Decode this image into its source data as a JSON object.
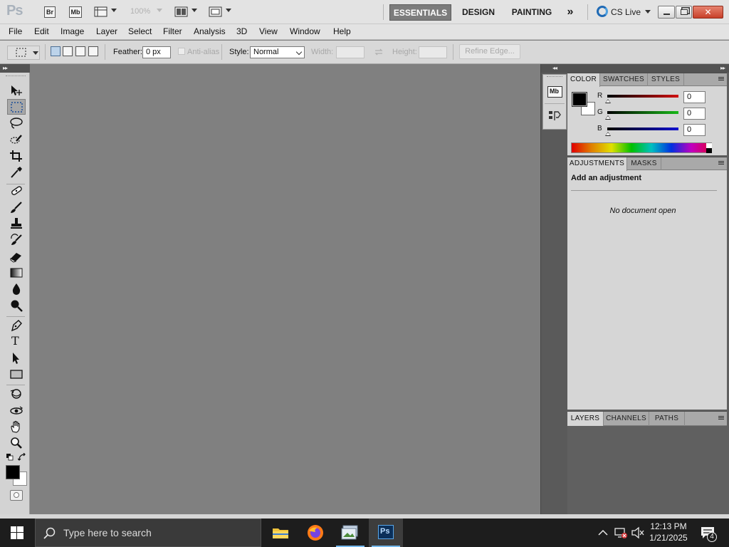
{
  "appbar": {
    "app_logo": "Ps",
    "bridge_label": "Br",
    "minibridge_label": "Mb",
    "zoom_level": "100%",
    "workspaces": [
      "ESSENTIALS",
      "DESIGN",
      "PAINTING"
    ],
    "active_workspace": "ESSENTIALS",
    "more_workspaces": "»",
    "cslive_label": "CS Live",
    "close_glyph": "✕"
  },
  "menu": {
    "items": [
      "File",
      "Edit",
      "Image",
      "Layer",
      "Select",
      "Filter",
      "Analysis",
      "3D",
      "View",
      "Window",
      "Help"
    ]
  },
  "options": {
    "feather_label": "Feather:",
    "feather_value": "0 px",
    "antialias_label": "Anti-alias",
    "style_label": "Style:",
    "style_value": "Normal",
    "width_label": "Width:",
    "height_label": "Height:",
    "refine_edge_label": "Refine Edge..."
  },
  "tools": {
    "collapse": "▸▸",
    "selected": "rectangular-marquee-tool",
    "type_tool_glyph": "T",
    "list": [
      "move-tool",
      "rectangular-marquee-tool",
      "lasso-tool",
      "quick-selection-tool",
      "crop-tool",
      "eyedropper-tool",
      "spot-healing-brush-tool",
      "brush-tool",
      "clone-stamp-tool",
      "history-brush-tool",
      "eraser-tool",
      "gradient-tool",
      "blur-tool",
      "dodge-tool",
      "pen-tool",
      "type-tool",
      "path-selection-tool",
      "rectangle-tool",
      "3d-rotate-tool",
      "3d-orbit-tool",
      "hand-tool",
      "zoom-tool"
    ],
    "foreground_color": "#000000",
    "background_color": "#ffffff"
  },
  "dock": {
    "collapse_left": "◂◂",
    "collapse_right": "▸▸",
    "minibridge_label": "Mb"
  },
  "color_panel": {
    "tabs": [
      "COLOR",
      "SWATCHES",
      "STYLES"
    ],
    "active_tab": "COLOR",
    "channels": [
      {
        "label": "R",
        "value": "0",
        "color": "#d01010"
      },
      {
        "label": "G",
        "value": "0",
        "color": "#18b818"
      },
      {
        "label": "B",
        "value": "0",
        "color": "#1010d0"
      }
    ],
    "foreground_color": "#000000",
    "background_color": "#ffffff"
  },
  "adjustments_panel": {
    "tabs": [
      "ADJUSTMENTS",
      "MASKS"
    ],
    "active_tab": "ADJUSTMENTS",
    "heading": "Add an adjustment",
    "empty_message": "No document open"
  },
  "layers_panel": {
    "tabs": [
      "LAYERS",
      "CHANNELS",
      "PATHS"
    ],
    "active_tab": "LAYERS"
  },
  "taskbar": {
    "search_placeholder": "Type here to search",
    "apps": [
      "file-explorer",
      "firefox",
      "photos",
      "photoshop"
    ],
    "active_app": "photoshop",
    "ps_label": "Ps",
    "time": "12:13 PM",
    "date": "1/21/2025",
    "notification_count": "4",
    "accent_color": "#76b9ed"
  }
}
